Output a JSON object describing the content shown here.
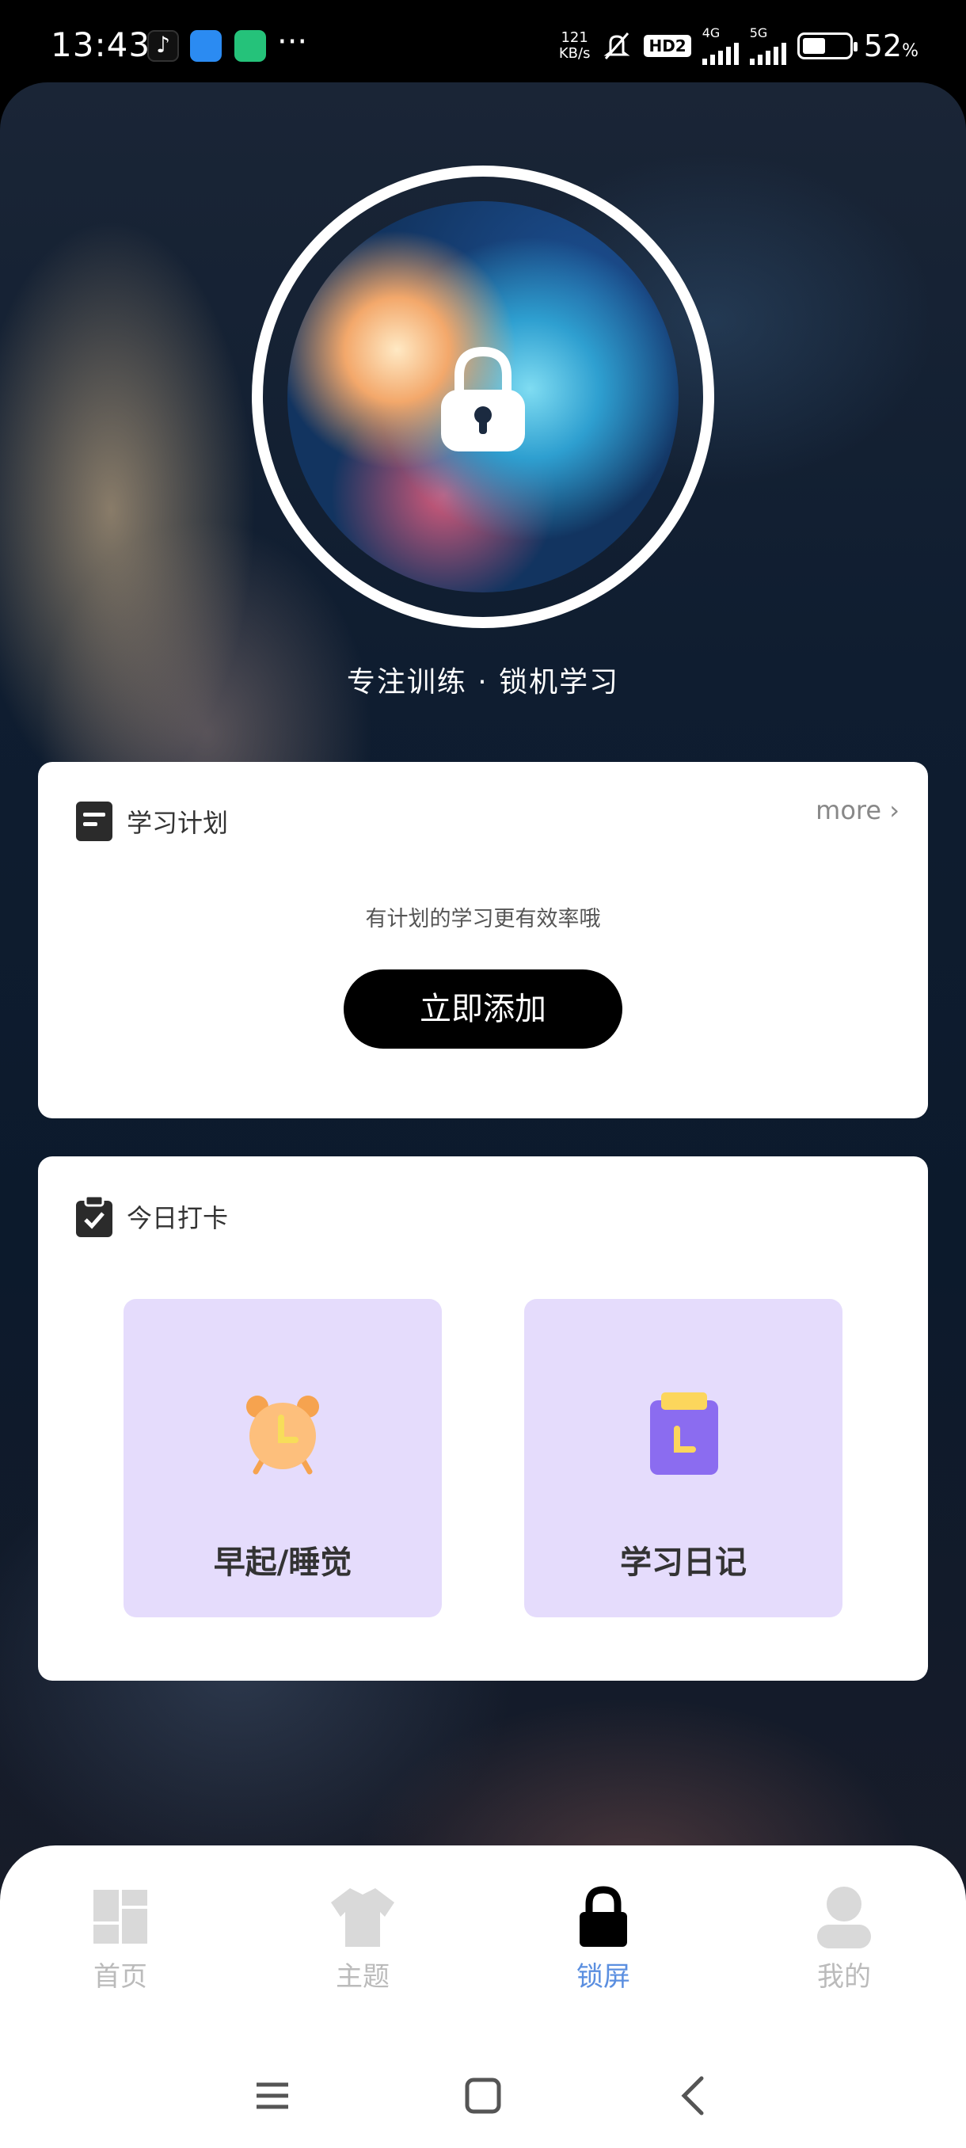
{
  "status_bar": {
    "time": "13:43",
    "speed_value": "121",
    "speed_unit": "KB/s",
    "hd_badge": "HD2",
    "net_4g": "4G",
    "net_5g": "5G",
    "battery_percent": "52",
    "battery_unit": "%",
    "battery_level": 0.52,
    "notification_overflow": "···"
  },
  "hero": {
    "caption": "专注训练 · 锁机学习"
  },
  "plan_card": {
    "title": "学习计划",
    "more_label": "more",
    "hint": "有计划的学习更有效率哦",
    "add_button": "立即添加"
  },
  "checkin_card": {
    "title": "今日打卡",
    "tiles": [
      {
        "label": "早起/睡觉",
        "icon": "alarm-clock-icon"
      },
      {
        "label": "学习日记",
        "icon": "diary-clipboard-icon"
      }
    ]
  },
  "tabbar": {
    "tabs": [
      {
        "label": "首页",
        "icon": "home-grid-icon",
        "active": false
      },
      {
        "label": "主题",
        "icon": "tshirt-icon",
        "active": false
      },
      {
        "label": "锁屏",
        "icon": "lock-icon",
        "active": true
      },
      {
        "label": "我的",
        "icon": "user-icon",
        "active": false
      }
    ]
  },
  "colors": {
    "accent": "#5b8fe0",
    "tile_bg": "#e5dcfc",
    "button_bg": "#000000"
  }
}
